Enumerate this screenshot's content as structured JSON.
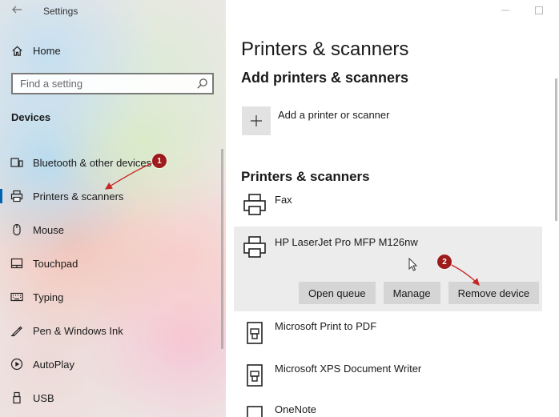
{
  "window": {
    "title": "Settings"
  },
  "sidebar": {
    "home_label": "Home",
    "search_placeholder": "Find a setting",
    "section_heading": "Devices",
    "items": [
      {
        "label": "Bluetooth & other devices",
        "icon": "bluetooth-devices-icon"
      },
      {
        "label": "Printers & scanners",
        "icon": "printer-icon",
        "selected": true
      },
      {
        "label": "Mouse",
        "icon": "mouse-icon"
      },
      {
        "label": "Touchpad",
        "icon": "touchpad-icon"
      },
      {
        "label": "Typing",
        "icon": "keyboard-icon"
      },
      {
        "label": "Pen & Windows Ink",
        "icon": "pen-icon"
      },
      {
        "label": "AutoPlay",
        "icon": "autoplay-icon"
      },
      {
        "label": "USB",
        "icon": "usb-icon"
      }
    ]
  },
  "main": {
    "page_title": "Printers & scanners",
    "add_heading": "Add printers & scanners",
    "add_label": "Add a printer or scanner",
    "list_heading": "Printers & scanners",
    "printers": [
      {
        "name": "Fax"
      },
      {
        "name": "HP LaserJet Pro MFP M126nw",
        "expanded": true
      },
      {
        "name": "Microsoft Print to PDF"
      },
      {
        "name": "Microsoft XPS Document Writer"
      },
      {
        "name": "OneNote"
      }
    ],
    "actions": {
      "open_queue": "Open queue",
      "manage": "Manage",
      "remove_device": "Remove device"
    }
  },
  "annotations": {
    "badge_1": "1",
    "badge_2": "2",
    "color": "#9e1b1b"
  },
  "colors": {
    "accent": "#0063b1",
    "button_bg": "#d5d5d5",
    "expanded_row_bg": "#ececec"
  }
}
